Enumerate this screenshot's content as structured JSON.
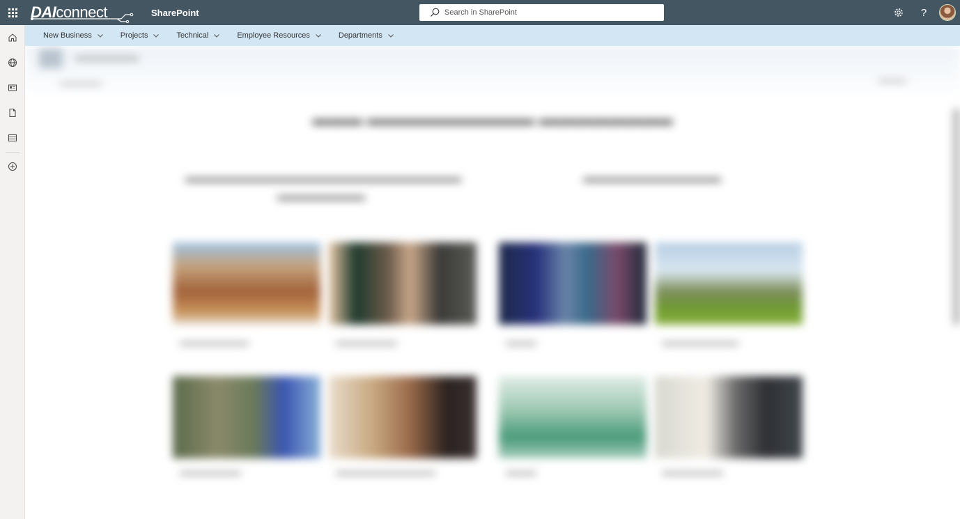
{
  "app": {
    "brand_strong": "DAI",
    "brand_light": "connect",
    "app_name": "SharePoint"
  },
  "search": {
    "placeholder": "Search in SharePoint"
  },
  "topbar": {
    "settings_icon": "gear-icon",
    "help_label": "?"
  },
  "hubnav": {
    "items": [
      {
        "label": "New Business"
      },
      {
        "label": "Projects"
      },
      {
        "label": "Technical"
      },
      {
        "label": "Employee Resources"
      },
      {
        "label": "Departments"
      }
    ]
  },
  "appbar": {
    "icons": [
      "home-icon",
      "globe-icon",
      "news-icon",
      "document-icon",
      "list-icon",
      "create-icon"
    ]
  },
  "colors": {
    "suitebar": "#455663",
    "hubnav": "#d3e6f4",
    "appbar": "#f3f2f1"
  }
}
